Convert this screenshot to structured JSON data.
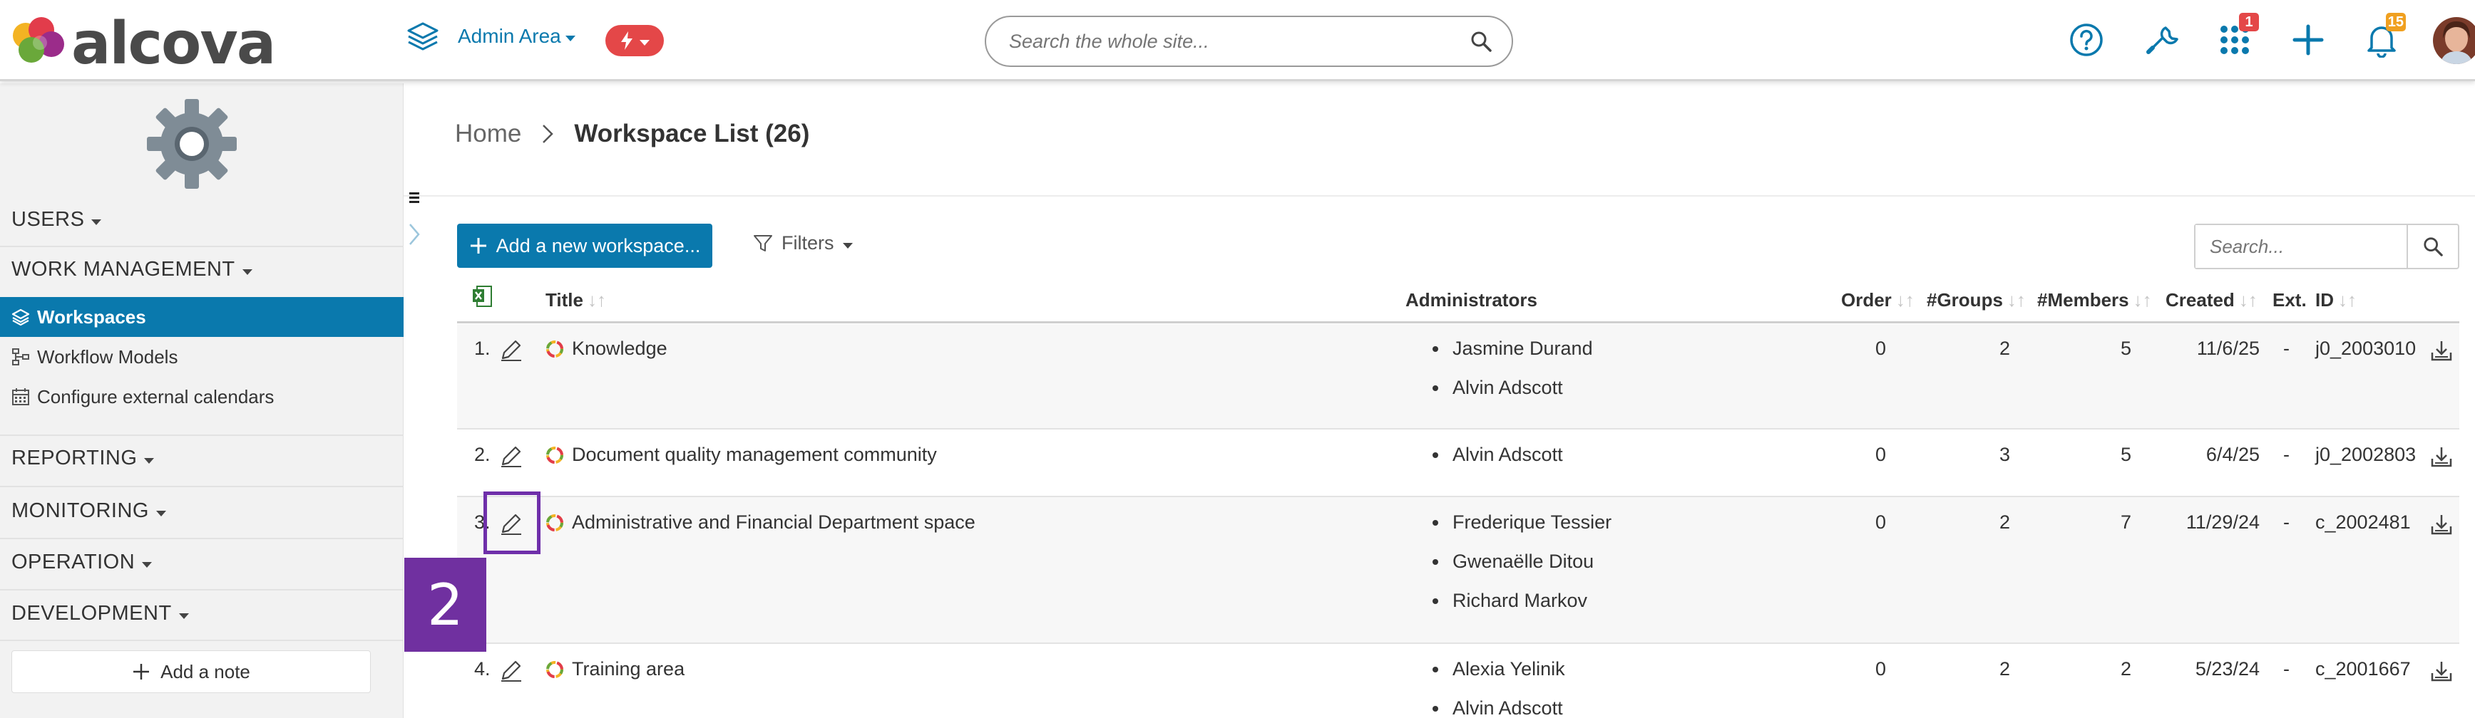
{
  "header": {
    "logo_text": "alcova",
    "admin_area_label": "Admin Area",
    "search_placeholder": "Search the whole site...",
    "apps_badge": "1",
    "notifications_badge": "15",
    "brand_color": "#0a79ad",
    "bolt_color": "#e44748"
  },
  "sidebar": {
    "users": "USERS",
    "work_management": "WORK MANAGEMENT",
    "items": [
      {
        "label": "Workspaces",
        "icon": "layers-icon",
        "active": true
      },
      {
        "label": "Workflow Models",
        "icon": "workflow-icon",
        "active": false
      },
      {
        "label": "Configure external calendars",
        "icon": "calendar-icon",
        "active": false
      }
    ],
    "reporting": "REPORTING",
    "monitoring": "MONITORING",
    "operation": "OPERATION",
    "development": "DEVELOPMENT",
    "add_note": "Add a note"
  },
  "breadcrumb": {
    "home": "Home",
    "current": "Workspace List (26)"
  },
  "toolbar": {
    "add_button": "Add a new workspace...",
    "filters": "Filters",
    "search_placeholder": "Search..."
  },
  "table": {
    "columns": {
      "title": "Title",
      "administrators": "Administrators",
      "order": "Order",
      "groups": "#Groups",
      "members": "#Members",
      "created": "Created",
      "ext": "Ext.",
      "id": "ID"
    },
    "rows": [
      {
        "index": "1.",
        "title": "Knowledge",
        "admins": [
          "Jasmine Durand",
          "Alvin Adscott"
        ],
        "order": "0",
        "groups": "2",
        "members": "5",
        "created": "11/6/25",
        "ext": "-",
        "id": "j0_2003010"
      },
      {
        "index": "2.",
        "title": "Document quality management community",
        "admins": [
          "Alvin Adscott"
        ],
        "order": "0",
        "groups": "3",
        "members": "5",
        "created": "6/4/25",
        "ext": "-",
        "id": "j0_2002803"
      },
      {
        "index": "3.",
        "title": "Administrative and Financial Department space",
        "admins": [
          "Frederique Tessier",
          "Gwenaëlle Ditou",
          "Richard Markov"
        ],
        "order": "0",
        "groups": "2",
        "members": "7",
        "created": "11/29/24",
        "ext": "-",
        "id": "c_2002481"
      },
      {
        "index": "4.",
        "title": "Training area",
        "admins": [
          "Alexia Yelinik",
          "Alvin Adscott"
        ],
        "order": "0",
        "groups": "2",
        "members": "2",
        "created": "5/23/24",
        "ext": "-",
        "id": "c_2001667"
      }
    ]
  },
  "annotation": {
    "step_number": "2",
    "color": "#7030a0"
  }
}
